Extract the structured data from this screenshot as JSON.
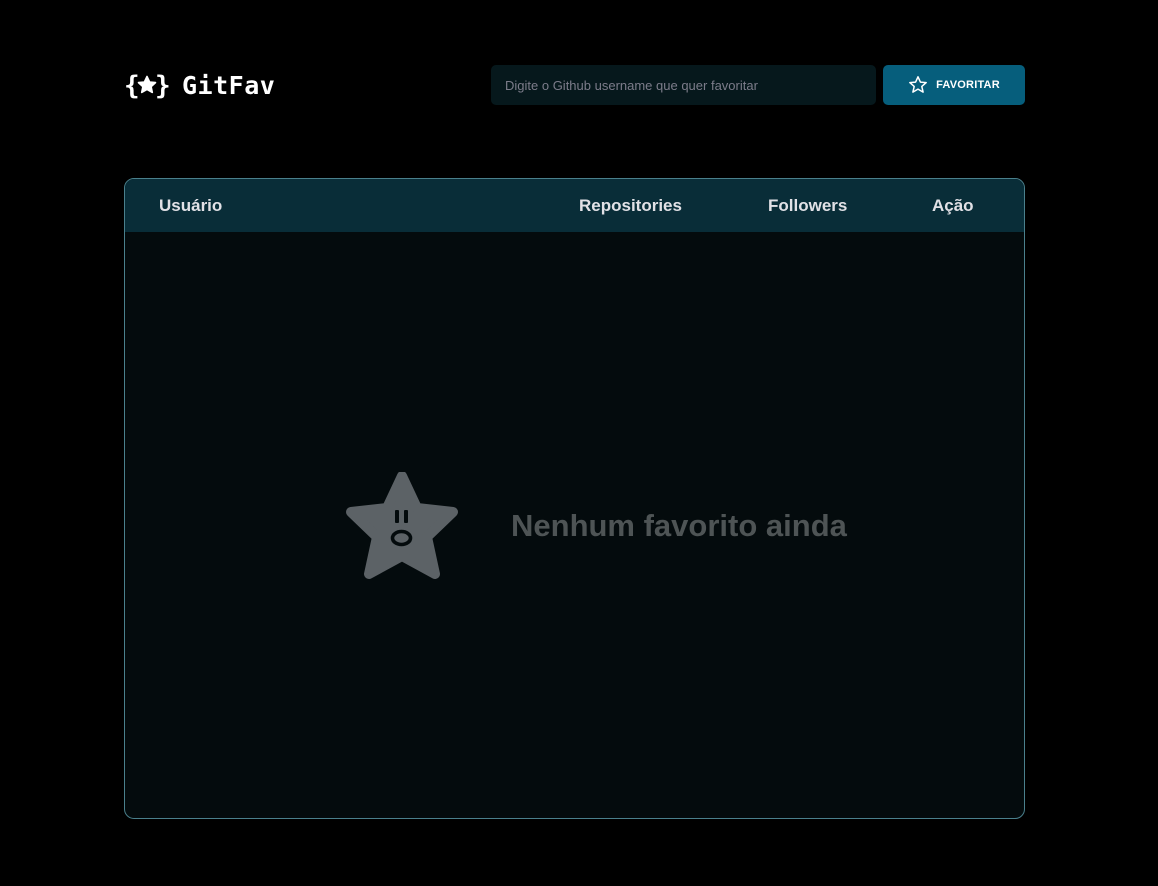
{
  "app": {
    "logo_text": "GitFav",
    "logo_icon": "braces-star-icon"
  },
  "search": {
    "placeholder": "Digite o Github username que quer favoritar",
    "value": "",
    "button_label": "FAVORITAR",
    "button_icon": "star-outline-icon"
  },
  "table": {
    "columns": [
      "Usuário",
      "Repositories",
      "Followers",
      "Ação"
    ],
    "rows": []
  },
  "empty_state": {
    "message": "Nenhum favorito ainda",
    "icon": "surprised-star-icon"
  },
  "colors": {
    "background": "#000000",
    "input_bg": "#06181C",
    "button_bg": "#065E7C",
    "table_header_bg": "#092D38",
    "table_body_bg": "#040B0D",
    "table_border": "#4A808C",
    "empty_text": "#4E5455",
    "empty_icon": "#5C6266"
  }
}
